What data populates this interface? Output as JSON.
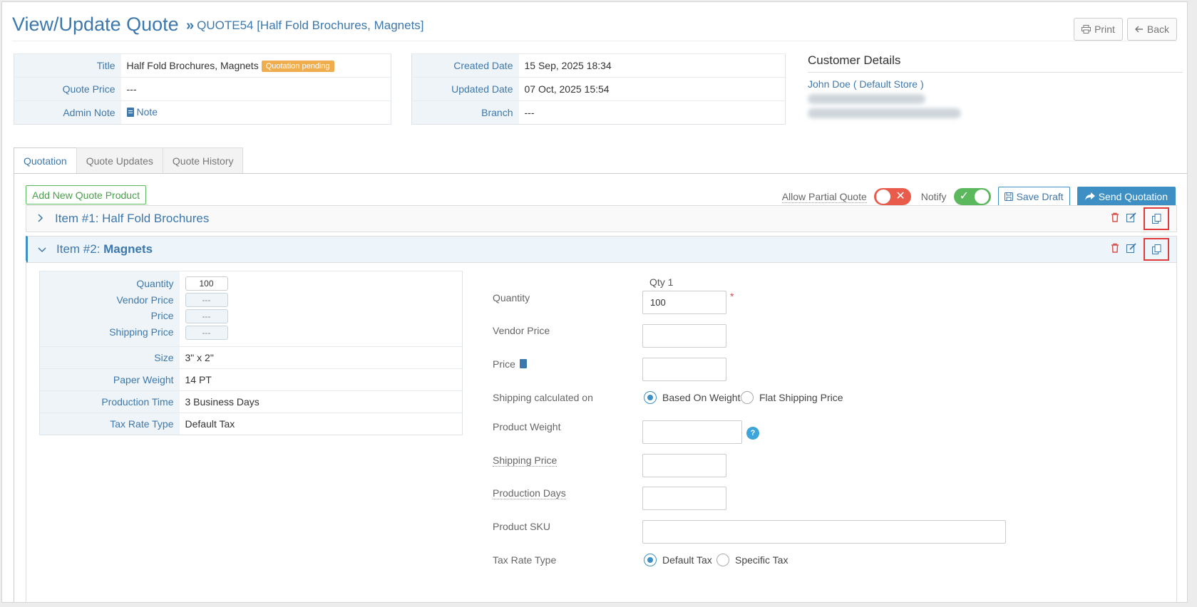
{
  "header": {
    "title": "View/Update Quote",
    "crumb_icon": "»",
    "crumb": "QUOTE54 [Half Fold Brochures, Magnets]",
    "print_label": "Print",
    "back_label": "Back"
  },
  "quote_info": [
    {
      "label": "Title",
      "value": "Half Fold Brochures, Magnets",
      "badge": "Quotation pending"
    },
    {
      "label": "Quote Price",
      "value": "---"
    },
    {
      "label": "Admin Note",
      "value": "Note"
    }
  ],
  "date_info": [
    {
      "label": "Created Date",
      "value": "15 Sep, 2025 18:34"
    },
    {
      "label": "Updated Date",
      "value": "07 Oct, 2025 15:54"
    },
    {
      "label": "Branch",
      "value": "---"
    }
  ],
  "customer": {
    "title": "Customer Details",
    "name": "John Doe ( Default Store )"
  },
  "tabs": [
    {
      "label": "Quotation",
      "active": true
    },
    {
      "label": "Quote Updates",
      "active": false
    },
    {
      "label": "Quote History",
      "active": false
    }
  ],
  "toolbar": {
    "add_product": "Add New Quote Product",
    "allow_partial": "Allow Partial Quote",
    "allow_partial_on": false,
    "notify": "Notify",
    "notify_on": true,
    "save_draft": "Save Draft",
    "send": "Send Quotation"
  },
  "items": [
    {
      "prefix": "Item #1: ",
      "name": "Half Fold Brochures",
      "expanded": false
    },
    {
      "prefix": "Item #2: ",
      "name": "Magnets",
      "expanded": true
    }
  ],
  "summary": {
    "price_labels": [
      "Quantity",
      "Vendor Price",
      "Price",
      "Shipping Price"
    ],
    "price_values": [
      "100",
      "---",
      "---",
      "---"
    ],
    "rows": [
      {
        "label": "Size",
        "value": "3\" x 2\""
      },
      {
        "label": "Paper Weight",
        "value": "14 PT"
      },
      {
        "label": "Production Time",
        "value": "3 Business Days"
      },
      {
        "label": "Tax Rate Type",
        "value": "Default Tax"
      }
    ]
  },
  "form": {
    "qty_header": "Qty 1",
    "quantity_label": "Quantity",
    "quantity_value": "100",
    "required_mark": "*",
    "vendor_price_label": "Vendor Price",
    "price_label": "Price",
    "shipping_calc_label": "Shipping calculated on",
    "shipping_opt_weight": "Based On Weight",
    "shipping_opt_flat": "Flat Shipping Price",
    "product_weight_label": "Product Weight",
    "help_mark": "?",
    "shipping_price_label": "Shipping Price",
    "production_days_label": "Production Days",
    "sku_label": "Product SKU",
    "tax_type_label": "Tax Rate Type",
    "tax_opt_default": "Default Tax",
    "tax_opt_specific": "Specific Tax"
  },
  "colors": {
    "primary": "#3d78ad",
    "badge": "#f0ad4e",
    "danger": "#e95b4a",
    "success": "#5cb85c",
    "highlight": "#e03a3a"
  }
}
